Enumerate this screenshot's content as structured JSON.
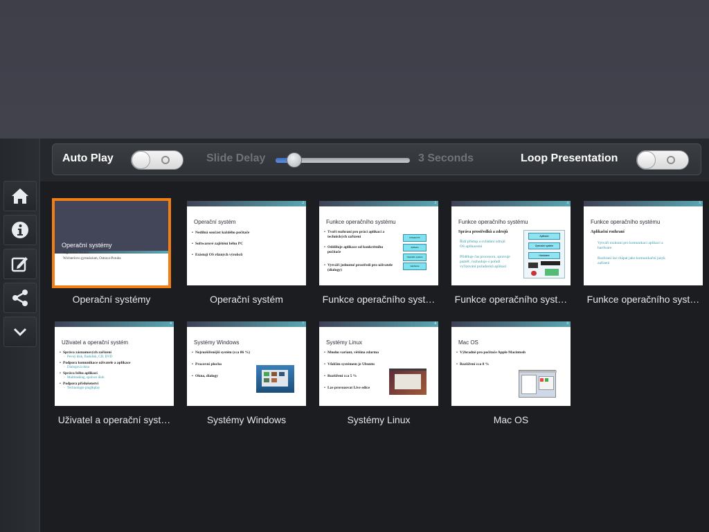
{
  "toolbar": {
    "auto_play_label": "Auto Play",
    "auto_play_on": false,
    "slide_delay_label": "Slide Delay",
    "slide_delay_value": "3 Seconds",
    "slide_delay_position": 0.12,
    "loop_label": "Loop Presentation",
    "loop_on": false
  },
  "sidebar": {
    "items": [
      {
        "icon": "home-icon"
      },
      {
        "icon": "info-icon"
      },
      {
        "icon": "edit-icon"
      },
      {
        "icon": "share-icon"
      },
      {
        "icon": "chevron-down-icon"
      }
    ]
  },
  "colors": {
    "selection": "#f07f17",
    "accent": "#3a6fc4"
  },
  "slides": [
    {
      "caption": "Operační systémy",
      "selected": true,
      "title": "Operační systémy",
      "lines": [
        "Mgr. Libor Kiubal",
        "Wichterlovo gymnázium, Ostrava-Poruba"
      ]
    },
    {
      "caption": "Operační systém",
      "title": "Operační systém",
      "bullets": [
        "Nedílná součást každého počítače",
        "Softwarové zajištění běhu PC",
        "Existují OS různých výrobců"
      ]
    },
    {
      "caption": "Funkce operačního syst…",
      "title": "Funkce operačního systému",
      "bullets": [
        "Tvoří rozhraní pro práci aplikací a technických zařízení",
        "Odděluje aplikace od konkrétního počítače",
        "Vytváří jednotné prostředí pro uživatele (dialogy)"
      ],
      "diagram": [
        "Uživatel PC",
        "Aplikace",
        "Operační systém",
        "Hardware"
      ]
    },
    {
      "caption": "Funkce operačního syst…",
      "title": "Funkce operačního systému",
      "subtitle": "Správa prostředků a zdrojů",
      "bullets": [
        "Řídí přístup a ovládání zdrojů OS aplikacemi",
        "Přiděluje čas procesoru, spravuje paměť, rozhoduje o pořadí vyřizování požadavků aplikací"
      ],
      "diagram": [
        "Aplikace",
        "Operační systém",
        "Hardware"
      ]
    },
    {
      "caption": "Funkce operačního syst…",
      "title": "Funkce operačního systému",
      "subtitle": "Aplikační rozhraní",
      "bullets": [
        "Vytváří rozhraní pro komunikaci aplikací a hardware",
        "Rozhraní lze chápat jako komunikační jazyk zařízení"
      ]
    },
    {
      "caption": "Uživatel a operační syst…",
      "title": "Uživatel a operační systém",
      "bullets": [
        "Správa záznamových zařízení",
        "Podpora komunikace uživatele a aplikace",
        "Správa běhu aplikací",
        "Podpora příslušenství"
      ],
      "subbullets": [
        "Pevný disk, flashdisk, CD, DVD",
        "Dialogová okna",
        "Multitasking, správce úloh",
        "Technologie plug&play"
      ]
    },
    {
      "caption": "Systémy Windows",
      "title": "Systémy Windows",
      "bullets": [
        "Nejrozšířenější systém (cca 86 %)",
        "Pracovní plocha",
        "Okna, dialogy"
      ]
    },
    {
      "caption": "Systémy Linux",
      "title": "Systémy Linux",
      "bullets": [
        "Mnoho variant, většina zdarma",
        "Vůdčím systémem je Ubuntu",
        "Rozšíření cca 5 %",
        "Lze provozovat Live edice"
      ]
    },
    {
      "caption": "Mac OS",
      "title": "Mac OS",
      "bullets": [
        "Výhradně pro počítače Apple Macintosh",
        "Rozšíření cca 8 %"
      ]
    }
  ]
}
